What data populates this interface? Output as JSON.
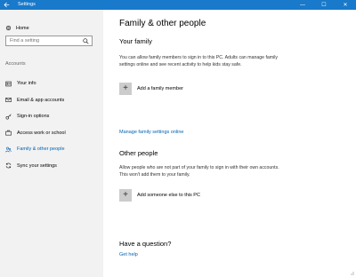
{
  "window": {
    "title": "Settings",
    "back_icon": "back-arrow-icon",
    "controls": {
      "minimize": "—",
      "maximize": "☐",
      "close": "✕"
    },
    "accent_color": "#1979ca"
  },
  "sidebar": {
    "home_label": "Home",
    "search_placeholder": "Find a setting",
    "section_label": "Accounts",
    "items": [
      {
        "label": "Your info",
        "icon": "person-card-icon",
        "active": false
      },
      {
        "label": "Email & app accounts",
        "icon": "mail-icon",
        "active": false
      },
      {
        "label": "Sign-in options",
        "icon": "key-icon",
        "active": false
      },
      {
        "label": "Access work or school",
        "icon": "briefcase-icon",
        "active": false
      },
      {
        "label": "Family & other people",
        "icon": "people-icon",
        "active": true
      },
      {
        "label": "Sync your settings",
        "icon": "sync-icon",
        "active": false
      }
    ],
    "active_color": "#0063b1"
  },
  "main": {
    "title": "Family & other people",
    "family": {
      "heading": "Your family",
      "description": "You can allow family members to sign in to this PC. Adults can manage family settings online and see recent activity to help kids stay safe.",
      "add_label": "Add a family member",
      "manage_link": "Manage family settings online"
    },
    "other": {
      "heading": "Other people",
      "description": "Allow people who are not part of your family to sign in with their own accounts. This won't add them to your family.",
      "add_label": "Add someone else to this PC"
    },
    "help": {
      "heading": "Have a question?",
      "link": "Get help"
    }
  }
}
